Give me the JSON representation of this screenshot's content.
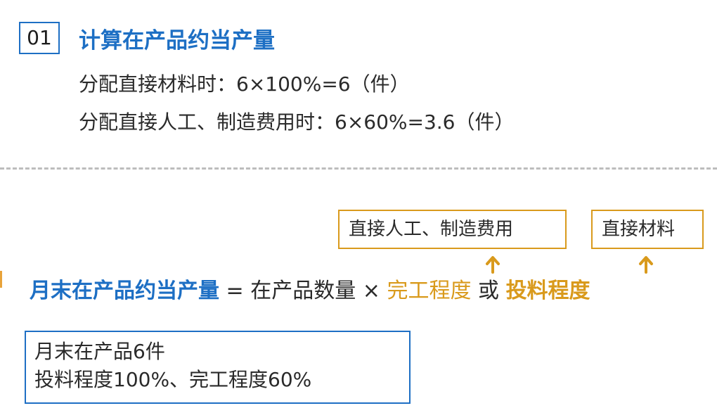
{
  "section": {
    "number": "01",
    "title": "计算在产品约当产量"
  },
  "calculations": [
    "分配直接材料时：6×100%=6（件）",
    "分配直接人工、制造费用时：6×60%=3.6（件）"
  ],
  "tags": {
    "labor": "直接人工、制造费用",
    "material": "直接材料"
  },
  "formula": {
    "lhs": "月末在产品约当产量",
    "equals": "=",
    "quantity": "在产品数量",
    "times": "×",
    "completion": "完工程度",
    "or": "或",
    "feed": "投料程度"
  },
  "info": {
    "line1": "月末在产品6件",
    "line2": "投料程度100%、完工程度60%"
  },
  "colors": {
    "blue": "#1d6fc4",
    "orange": "#d99a1c",
    "divider": "#bdbdbd"
  }
}
